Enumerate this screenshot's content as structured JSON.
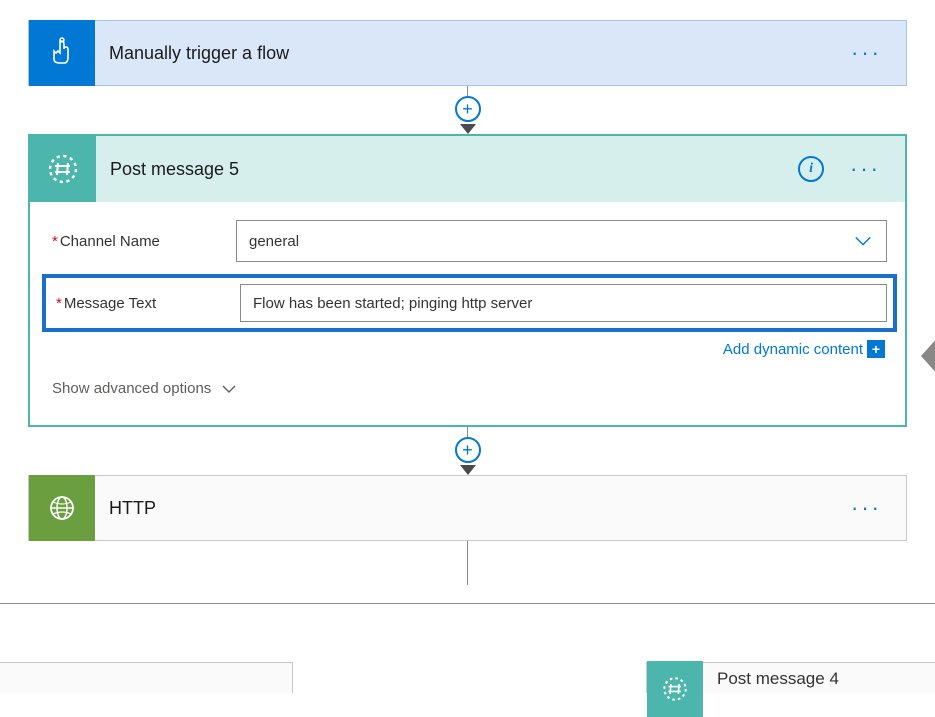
{
  "trigger": {
    "title": "Manually trigger a flow",
    "more_label": "···"
  },
  "action": {
    "title": "Post message 5",
    "info_label": "i",
    "more_label": "···",
    "fields": {
      "channel_label": "Channel Name",
      "channel_value": "general",
      "message_label": "Message Text",
      "message_value": "Flow has been started; pinging http server"
    },
    "dynamic_link": "Add dynamic content",
    "dynamic_badge": "+",
    "advanced_toggle": "Show advanced options"
  },
  "http": {
    "title": "HTTP",
    "more_label": "···"
  },
  "bottom_right": {
    "title": "Post message 4"
  },
  "connector": {
    "plus": "+"
  }
}
